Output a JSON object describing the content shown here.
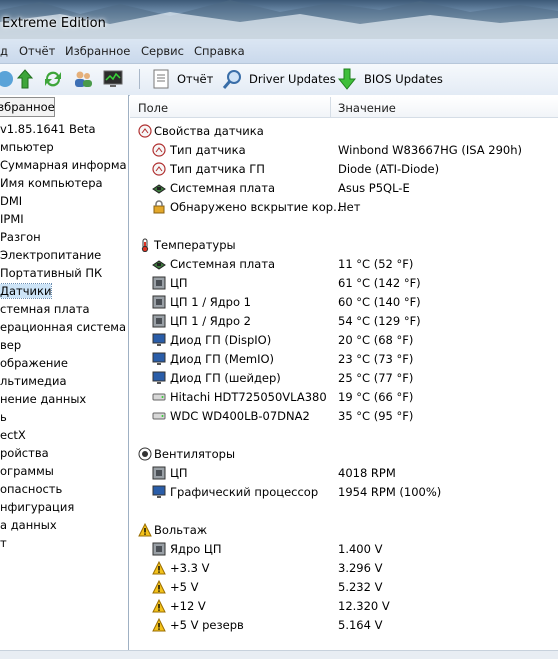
{
  "window": {
    "title": "Extreme Edition"
  },
  "menu": [
    "д",
    "Отчёт",
    "Избранное",
    "Сервис",
    "Справка"
  ],
  "toolbar": {
    "report": "Отчёт",
    "driver_updates": "Driver Updates",
    "bios_updates": "BIOS Updates"
  },
  "left_panel": {
    "tab_label": "збранное",
    "items": [
      {
        "label": "v1.85.1641 Beta"
      },
      {
        "label": "мпьютер"
      },
      {
        "label": "Суммарная информа"
      },
      {
        "label": "Имя компьютера"
      },
      {
        "label": "DMI"
      },
      {
        "label": "IPMI"
      },
      {
        "label": "Разгон"
      },
      {
        "label": "Электропитание"
      },
      {
        "label": "Портативный ПК"
      },
      {
        "label": "Датчики",
        "selected": true
      },
      {
        "label": "стемная плата"
      },
      {
        "label": "ерационная система"
      },
      {
        "label": "вер"
      },
      {
        "label": "ображение"
      },
      {
        "label": "льтимедиа"
      },
      {
        "label": "нение данных"
      },
      {
        "label": "ь"
      },
      {
        "label": "ectX"
      },
      {
        "label": "ройства"
      },
      {
        "label": "ограммы"
      },
      {
        "label": "опасность"
      },
      {
        "label": "нфигурация"
      },
      {
        "label": "а данных"
      },
      {
        "label": "т"
      }
    ]
  },
  "grid": {
    "col_field": "Поле",
    "col_value": "Значение",
    "rows": [
      {
        "kind": "section",
        "icon": "sensor-icon",
        "field": "Свойства датчика",
        "value": ""
      },
      {
        "kind": "item",
        "icon": "sensor-icon",
        "field": "Тип датчика",
        "value": "Winbond W83667HG  (ISA 290h)"
      },
      {
        "kind": "item",
        "icon": "sensor-icon",
        "field": "Тип датчика ГП",
        "value": "Diode  (ATI-Diode)"
      },
      {
        "kind": "item",
        "icon": "motherboard-icon",
        "field": "Системная плата",
        "value": "Asus P5QL-E"
      },
      {
        "kind": "item",
        "icon": "lock-icon",
        "field": "Обнаружено вскрытие кор...",
        "value": "Нет"
      },
      {
        "kind": "blank"
      },
      {
        "kind": "section",
        "icon": "thermometer-icon",
        "field": "Температуры",
        "value": ""
      },
      {
        "kind": "item",
        "icon": "motherboard-icon",
        "field": "Системная плата",
        "value": "11 °C  (52 °F)"
      },
      {
        "kind": "item",
        "icon": "cpu-icon",
        "field": "ЦП",
        "value": "61 °C  (142 °F)"
      },
      {
        "kind": "item",
        "icon": "cpu-icon",
        "field": "ЦП 1 / Ядро 1",
        "value": "60 °C  (140 °F)"
      },
      {
        "kind": "item",
        "icon": "cpu-icon",
        "field": "ЦП 1 / Ядро 2",
        "value": "54 °C  (129 °F)"
      },
      {
        "kind": "item",
        "icon": "monitor-icon",
        "field": "Диод ГП (DispIO)",
        "value": "20 °C  (68 °F)"
      },
      {
        "kind": "item",
        "icon": "monitor-icon",
        "field": "Диод ГП (MemIO)",
        "value": "23 °C  (73 °F)"
      },
      {
        "kind": "item",
        "icon": "monitor-icon",
        "field": "Диод ГП (шейдер)",
        "value": "25 °C  (77 °F)"
      },
      {
        "kind": "item",
        "icon": "disk-icon",
        "field": "Hitachi HDT725050VLA380",
        "value": "19 °C  (66 °F)"
      },
      {
        "kind": "item",
        "icon": "disk-icon",
        "field": "WDC WD400LB-07DNA2",
        "value": "35 °C  (95 °F)"
      },
      {
        "kind": "blank"
      },
      {
        "kind": "section",
        "icon": "fan-icon",
        "field": "Вентиляторы",
        "value": ""
      },
      {
        "kind": "item",
        "icon": "cpu-icon",
        "field": "ЦП",
        "value": "4018 RPM"
      },
      {
        "kind": "item",
        "icon": "monitor-icon",
        "field": "Графический процессор",
        "value": "1954 RPM  (100%)"
      },
      {
        "kind": "blank"
      },
      {
        "kind": "section",
        "icon": "warning-icon",
        "field": "Вольтаж",
        "value": ""
      },
      {
        "kind": "item",
        "icon": "cpu-icon",
        "field": "Ядро ЦП",
        "value": "1.400 V"
      },
      {
        "kind": "item",
        "icon": "warning-icon",
        "field": "+3.3 V",
        "value": "3.296 V"
      },
      {
        "kind": "item",
        "icon": "warning-icon",
        "field": "+5 V",
        "value": "5.232 V"
      },
      {
        "kind": "item",
        "icon": "warning-icon",
        "field": "+12 V",
        "value": "12.320 V"
      },
      {
        "kind": "item",
        "icon": "warning-icon",
        "field": "+5 V резерв",
        "value": "5.164 V"
      }
    ]
  }
}
